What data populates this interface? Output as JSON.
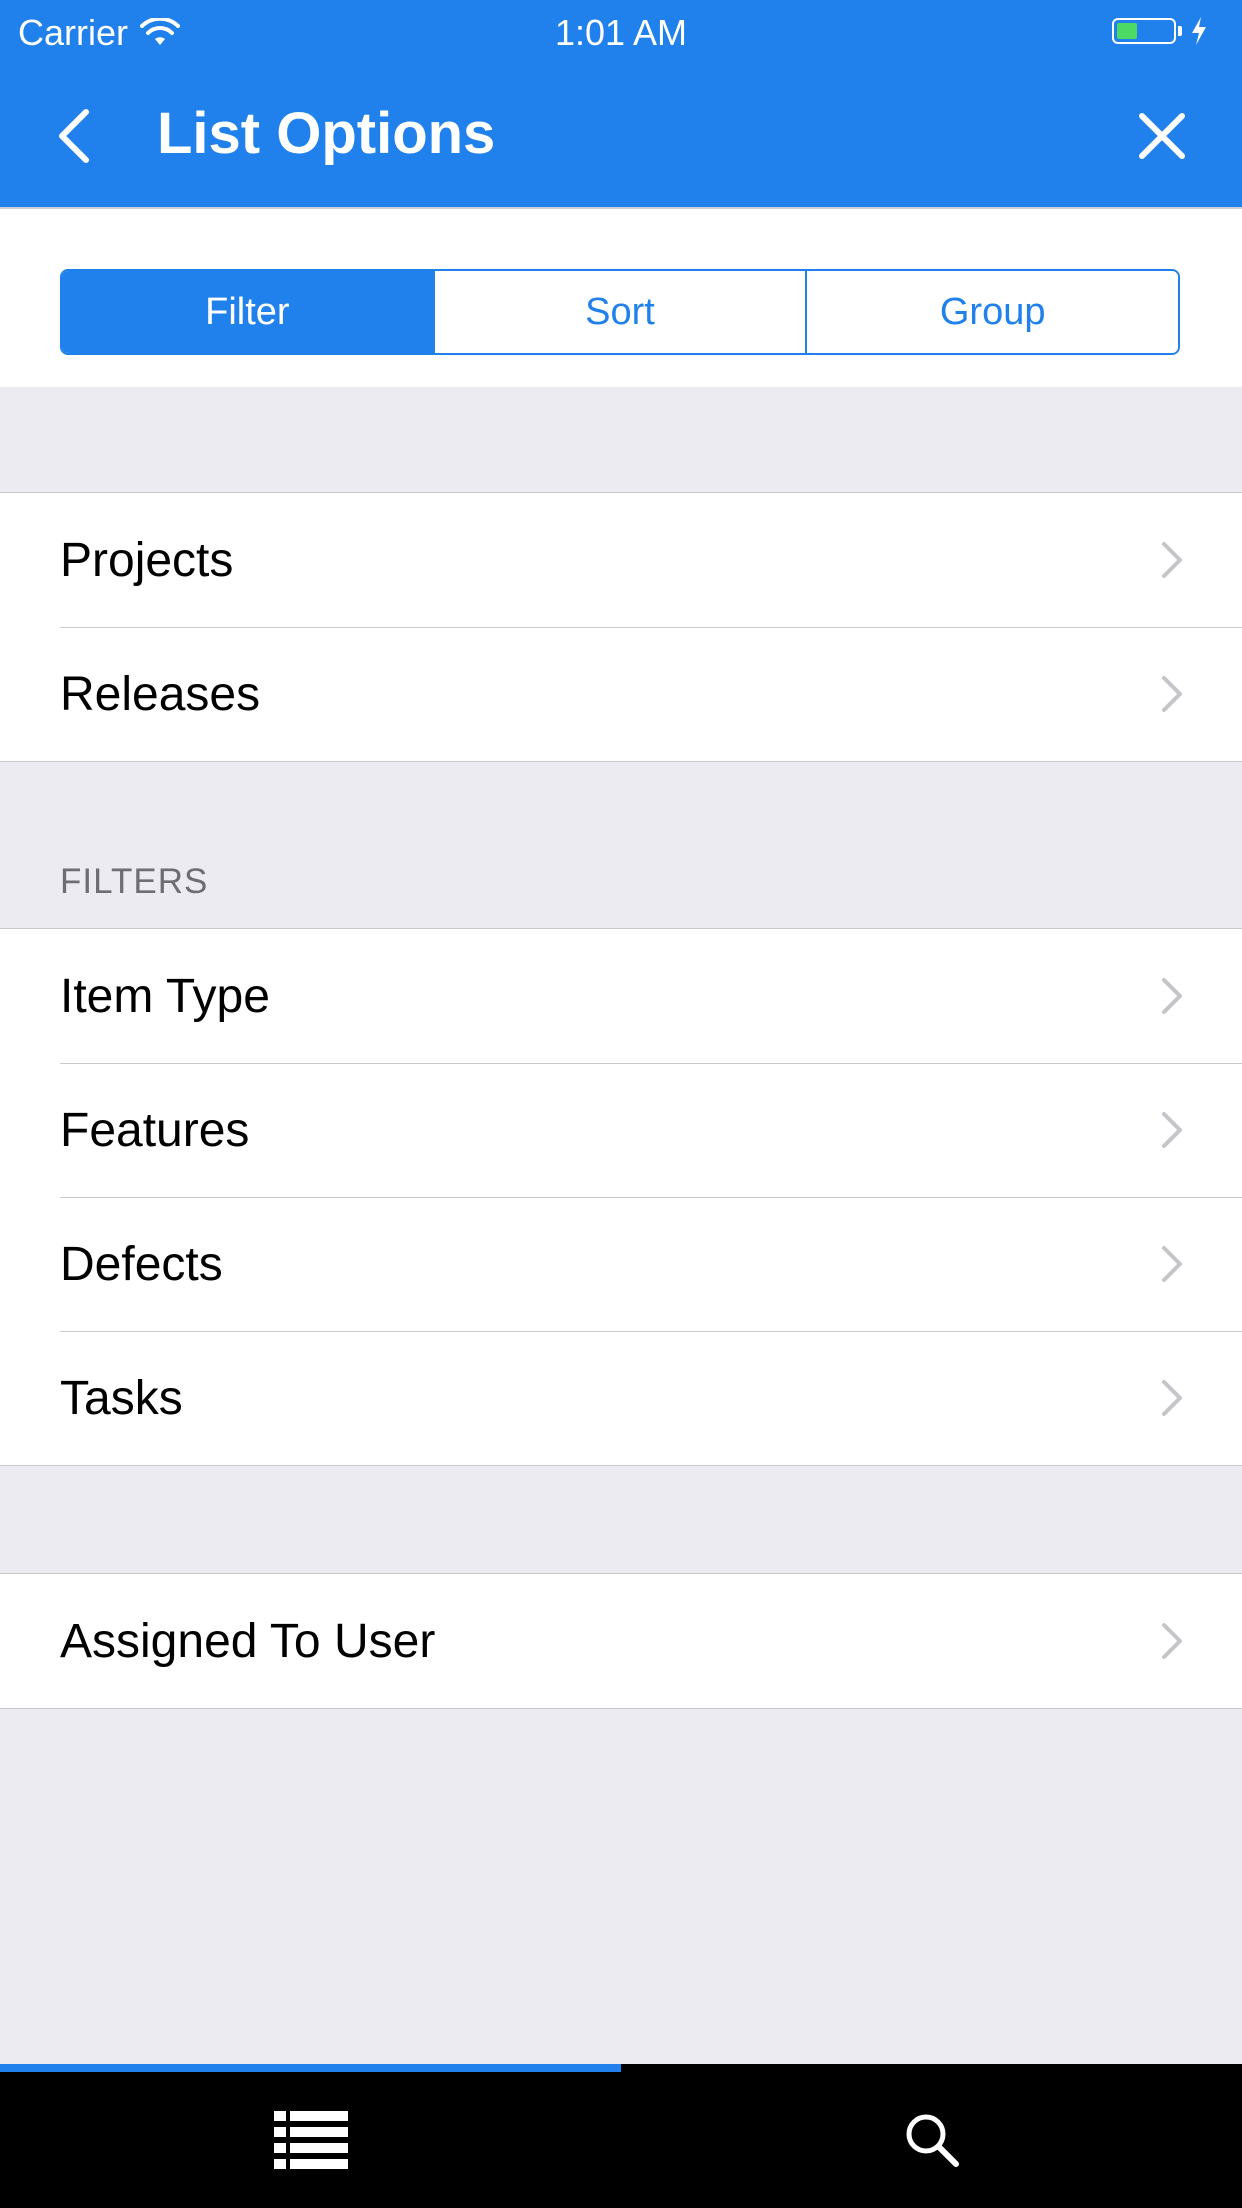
{
  "status": {
    "carrier": "Carrier",
    "time": "1:01 AM"
  },
  "nav": {
    "title": "List Options"
  },
  "segments": [
    {
      "label": "Filter",
      "active": true
    },
    {
      "label": "Sort",
      "active": false
    },
    {
      "label": "Group",
      "active": false
    }
  ],
  "group1": [
    {
      "label": "Projects"
    },
    {
      "label": "Releases"
    }
  ],
  "filters_header": "FILTERS",
  "filters": [
    {
      "label": "Item Type"
    },
    {
      "label": "Features"
    },
    {
      "label": "Defects"
    },
    {
      "label": "Tasks"
    }
  ],
  "group3": [
    {
      "label": "Assigned To User"
    }
  ],
  "colors": {
    "accent": "#2081ed",
    "background": "#ebebf1",
    "tabbar": "#000000"
  },
  "tabbar": {
    "tabs": [
      {
        "icon": "list-icon",
        "selected": true
      },
      {
        "icon": "search-icon",
        "selected": false
      }
    ]
  }
}
